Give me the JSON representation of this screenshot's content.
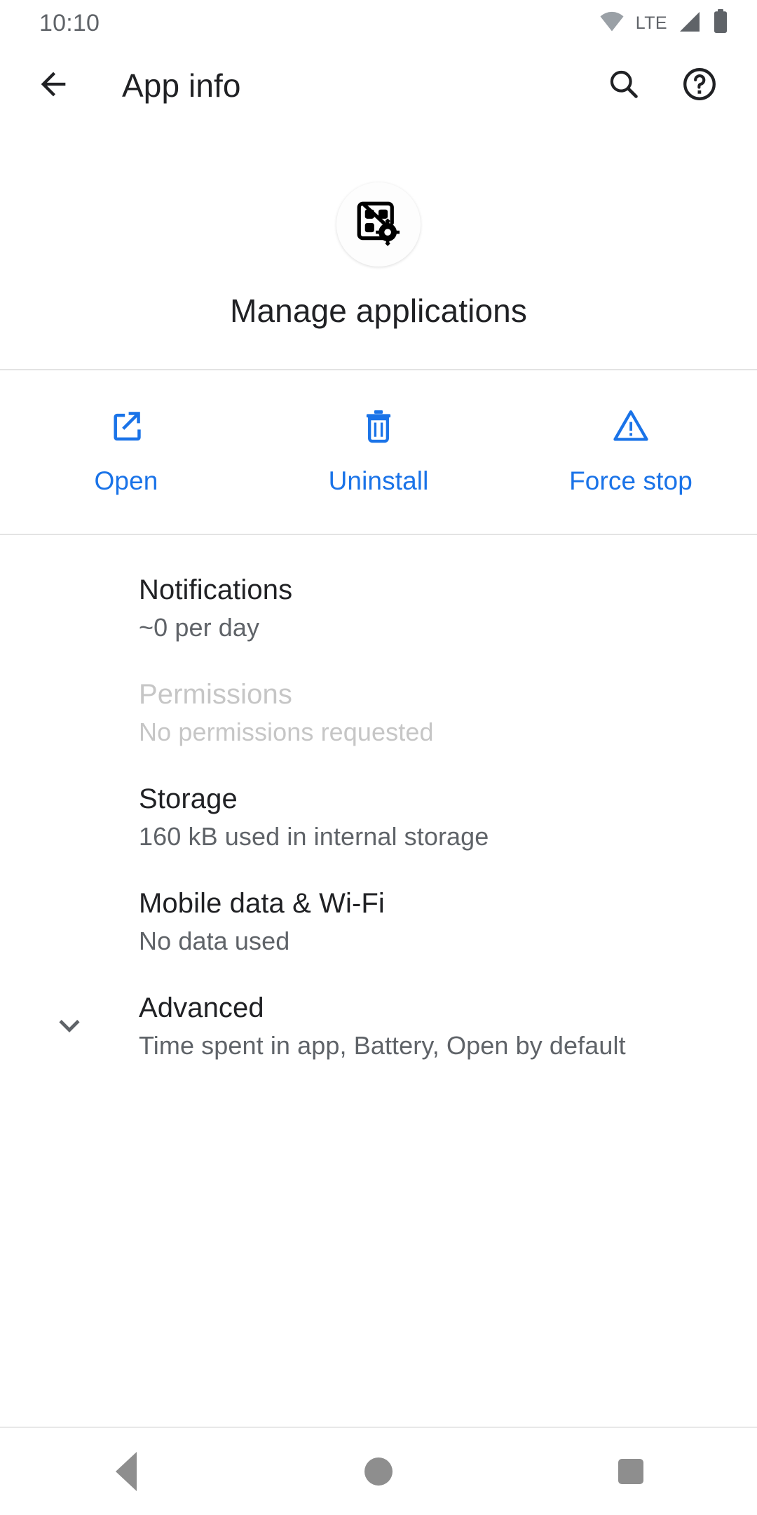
{
  "status_bar": {
    "time": "10:10",
    "network_label": "LTE",
    "wifi_icon": "wifi-icon",
    "signal_icon": "cellular-signal-icon",
    "battery_icon": "battery-full-icon"
  },
  "app_bar": {
    "back_icon": "arrow-back-icon",
    "title": "App info",
    "search_icon": "search-icon",
    "help_icon": "help-circle-icon"
  },
  "app_header": {
    "app_icon": "manage-applications-icon",
    "app_name": "Manage applications"
  },
  "actions": [
    {
      "label": "Open",
      "icon": "open-in-new-icon"
    },
    {
      "label": "Uninstall",
      "icon": "trash-icon"
    },
    {
      "label": "Force stop",
      "icon": "warning-triangle-icon"
    }
  ],
  "settings": [
    {
      "title": "Notifications",
      "subtitle": "~0 per day",
      "disabled": false,
      "has_chevron": false
    },
    {
      "title": "Permissions",
      "subtitle": "No permissions requested",
      "disabled": true,
      "has_chevron": false
    },
    {
      "title": "Storage",
      "subtitle": "160 kB used in internal storage",
      "disabled": false,
      "has_chevron": false
    },
    {
      "title": "Mobile data & Wi-Fi",
      "subtitle": "No data used",
      "disabled": false,
      "has_chevron": false
    },
    {
      "title": "Advanced",
      "subtitle": "Time spent in app, Battery, Open by default",
      "disabled": false,
      "has_chevron": true,
      "chevron_icon": "chevron-down-icon"
    }
  ],
  "nav_bar": {
    "back_icon": "nav-back-icon",
    "home_icon": "nav-home-icon",
    "recents_icon": "nav-recents-icon"
  },
  "colors": {
    "accent_blue": "#1a73e8",
    "primary_text": "#202124",
    "secondary_text": "#5f6368",
    "disabled_text": "#c6c6c6",
    "divider": "#e3e3e3",
    "nav_icon": "#8e8e8e"
  }
}
